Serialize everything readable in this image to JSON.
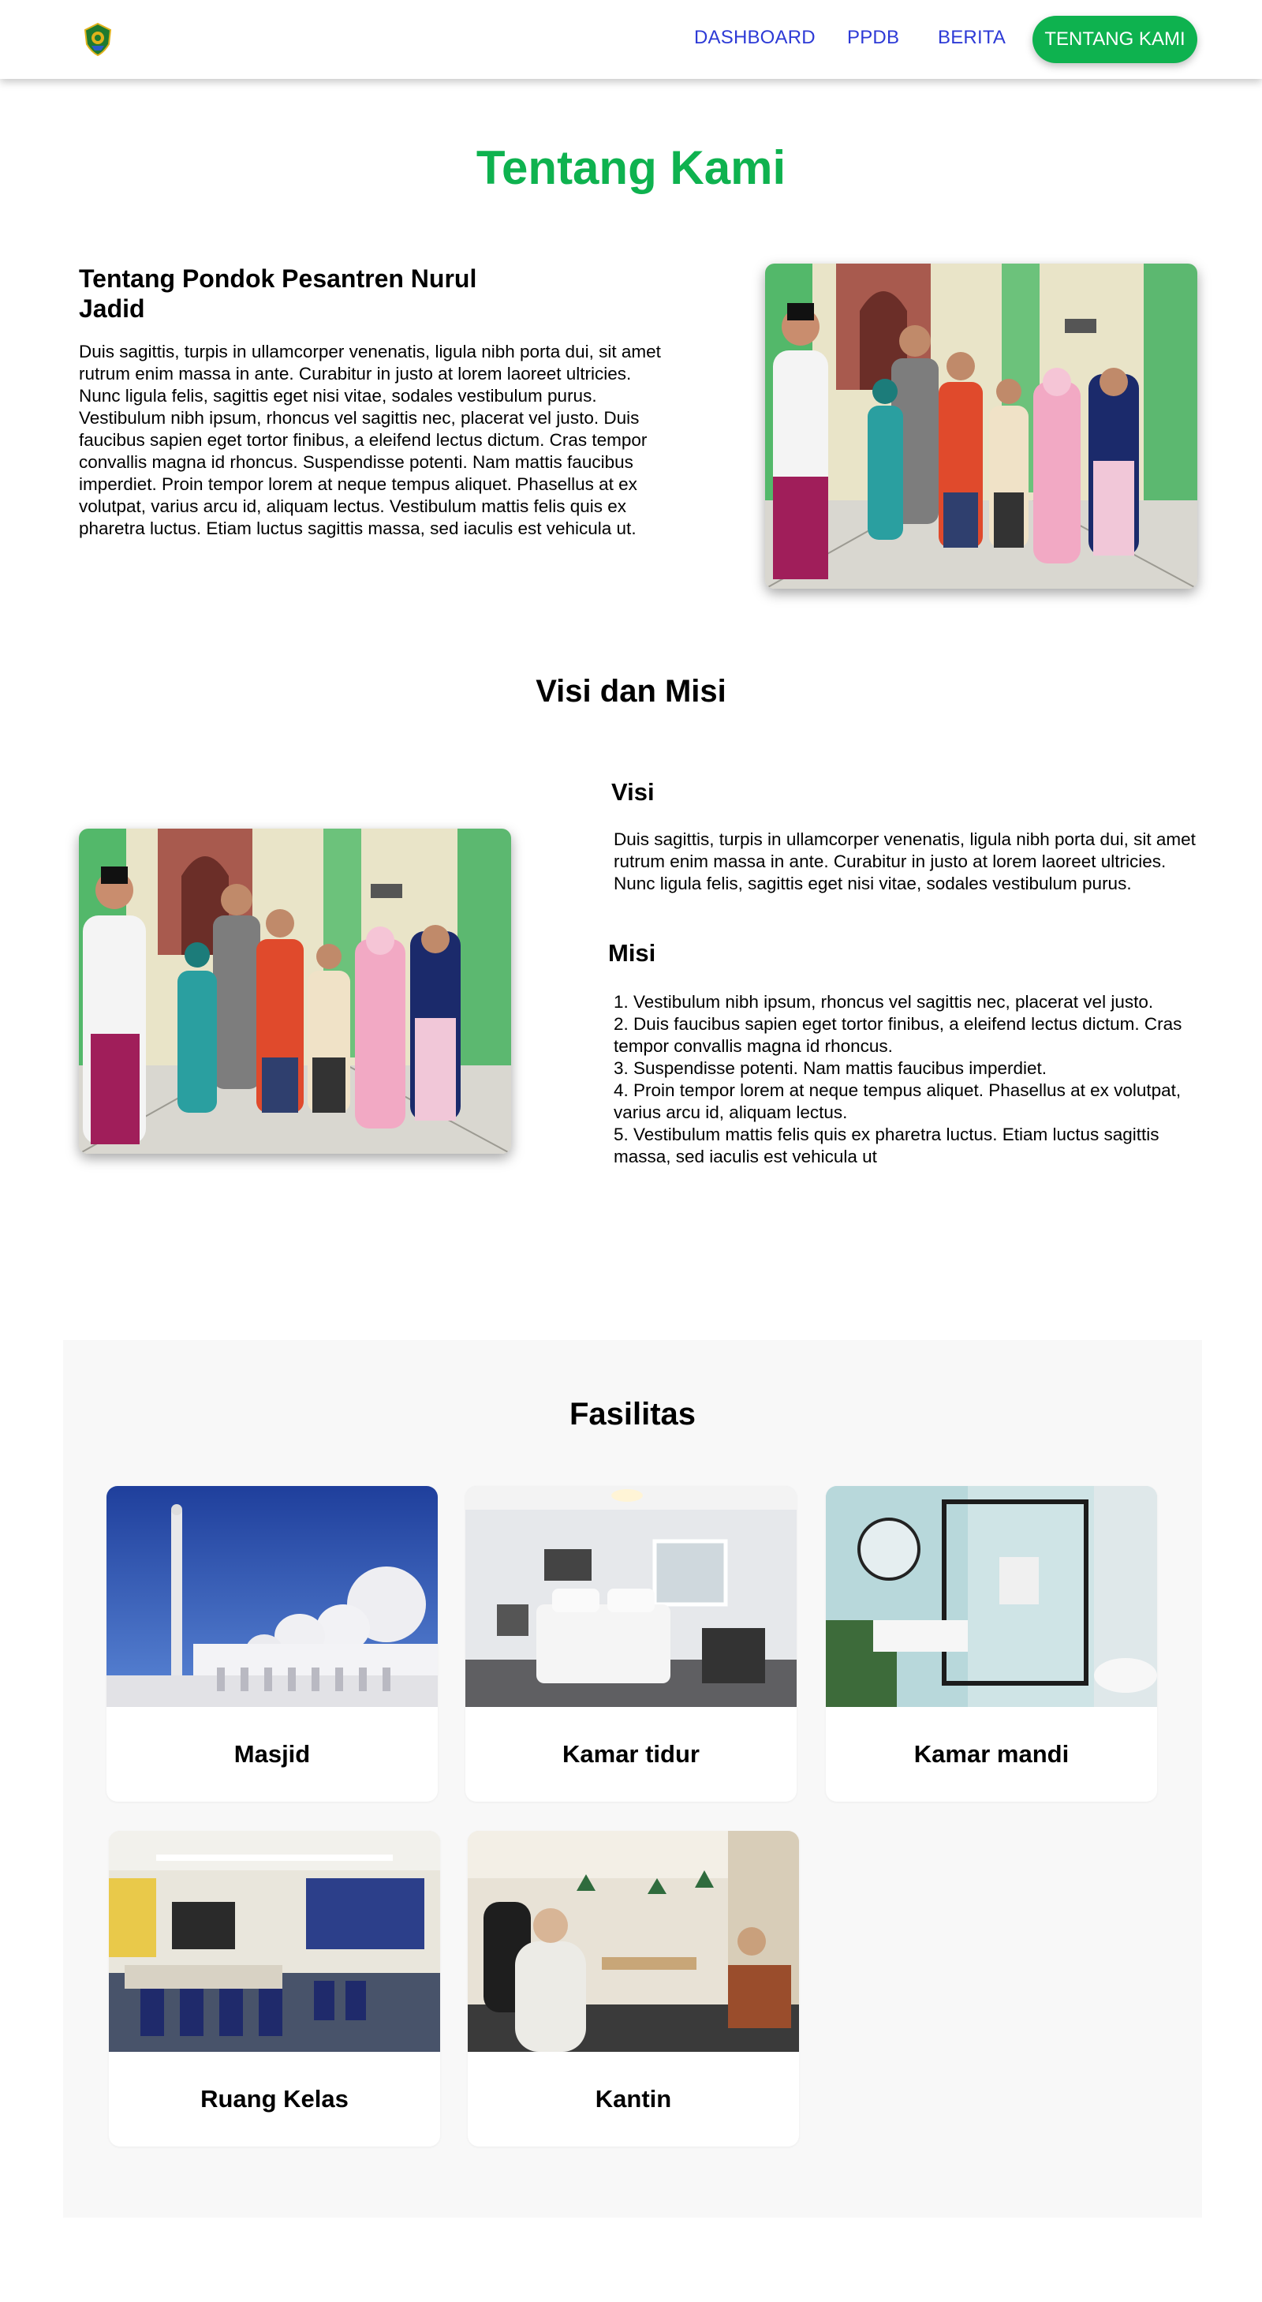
{
  "nav": {
    "logo_icon": "crest-logo-icon",
    "dashboard": "DASHBOARD",
    "ppdb": "PPDB",
    "berita": "BERITA",
    "tentang": "TENTANG KAMI",
    "accent": "#0eb24f",
    "link_color": "#2d3ad6"
  },
  "page": {
    "title": "Tentang Kami"
  },
  "about": {
    "heading": "Tentang Pondok Pesantren Nurul Jadid",
    "text": "Duis sagittis, turpis in ullamcorper venenatis, ligula nibh porta dui, sit amet rutrum enim massa in ante. Curabitur in justo at lorem laoreet ultricies. Nunc ligula felis, sagittis eget nisi vitae, sodales vestibulum purus. Vestibulum nibh ipsum, rhoncus vel sagittis nec, placerat vel justo. Duis faucibus sapien eget tortor finibus, a eleifend lectus dictum. Cras tempor convallis magna id rhoncus. Suspendisse potenti. Nam mattis faucibus imperdiet. Proin tempor lorem at neque tempus aliquet. Phasellus at ex volutpat, varius arcu id, aliquam lectus. Vestibulum mattis felis quis ex pharetra luctus. Etiam luctus sagittis massa, sed iaculis est vehicula ut."
  },
  "visi_misi": {
    "title": "Visi dan Misi",
    "visi_label": "Visi",
    "visi_text": "Duis sagittis, turpis in ullamcorper venenatis, ligula nibh porta dui, sit amet rutrum enim massa in ante. Curabitur in justo at lorem laoreet ultricies. Nunc ligula felis, sagittis eget nisi vitae, sodales vestibulum purus.",
    "misi_label": "Misi",
    "misi_items": [
      "1. Vestibulum nibh ipsum, rhoncus vel sagittis nec, placerat vel justo.",
      "2. Duis faucibus sapien eget tortor finibus, a eleifend lectus dictum. Cras tempor convallis magna id rhoncus.",
      "3. Suspendisse potenti. Nam mattis faucibus imperdiet.",
      "4. Proin tempor lorem at neque tempus aliquet. Phasellus at ex volutpat, varius arcu id, aliquam lectus.",
      "5. Vestibulum mattis felis quis ex pharetra luctus. Etiam luctus sagittis massa, sed iaculis est vehicula ut"
    ]
  },
  "fasilitas": {
    "title": "Fasilitas",
    "items": [
      {
        "label": "Masjid"
      },
      {
        "label": "Kamar tidur"
      },
      {
        "label": "Kamar mandi"
      },
      {
        "label": "Ruang Kelas"
      },
      {
        "label": "Kantin"
      }
    ]
  }
}
